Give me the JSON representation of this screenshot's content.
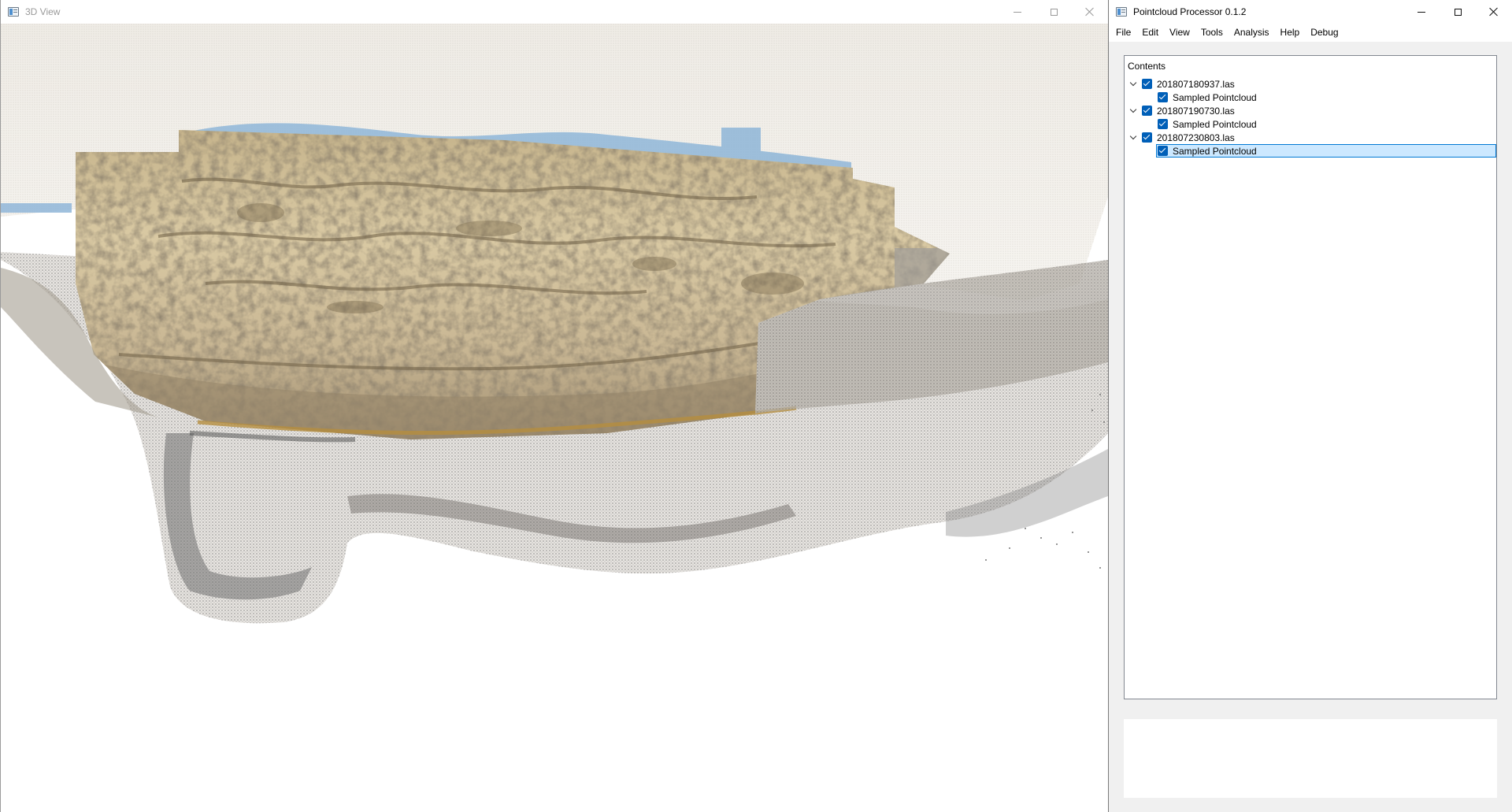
{
  "view3d": {
    "title": "3D View",
    "icons": {
      "app": "app-window-icon",
      "minimize": "minimize-icon",
      "maximize": "maximize-icon",
      "close": "close-icon"
    }
  },
  "processor": {
    "title": "Pointcloud Processor 0.1.2",
    "icons": {
      "app": "app-window-icon",
      "minimize": "minimize-icon",
      "maximize": "maximize-icon",
      "close": "close-icon"
    },
    "menu": [
      "File",
      "Edit",
      "View",
      "Tools",
      "Analysis",
      "Help",
      "Debug"
    ],
    "contents": {
      "header": "Contents",
      "files": [
        {
          "name": "201807180937.las",
          "checked": true,
          "expanded": true,
          "children": [
            {
              "name": "Sampled Pointcloud",
              "checked": true,
              "selected": false
            }
          ]
        },
        {
          "name": "201807190730.las",
          "checked": true,
          "expanded": true,
          "children": [
            {
              "name": "Sampled Pointcloud",
              "checked": true,
              "selected": false
            }
          ]
        },
        {
          "name": "201807230803.las",
          "checked": true,
          "expanded": true,
          "children": [
            {
              "name": "Sampled Pointcloud",
              "checked": true,
              "selected": true
            }
          ]
        }
      ]
    }
  },
  "colors": {
    "accent": "#005fb8",
    "selection_bg": "#cce8ff",
    "selection_border": "#0078d4",
    "rock_light": "#d8c9a4",
    "rock_dark": "#8c7d60",
    "shell_gray": "#8a8a8a",
    "sky_blue": "#8fb6d8"
  }
}
